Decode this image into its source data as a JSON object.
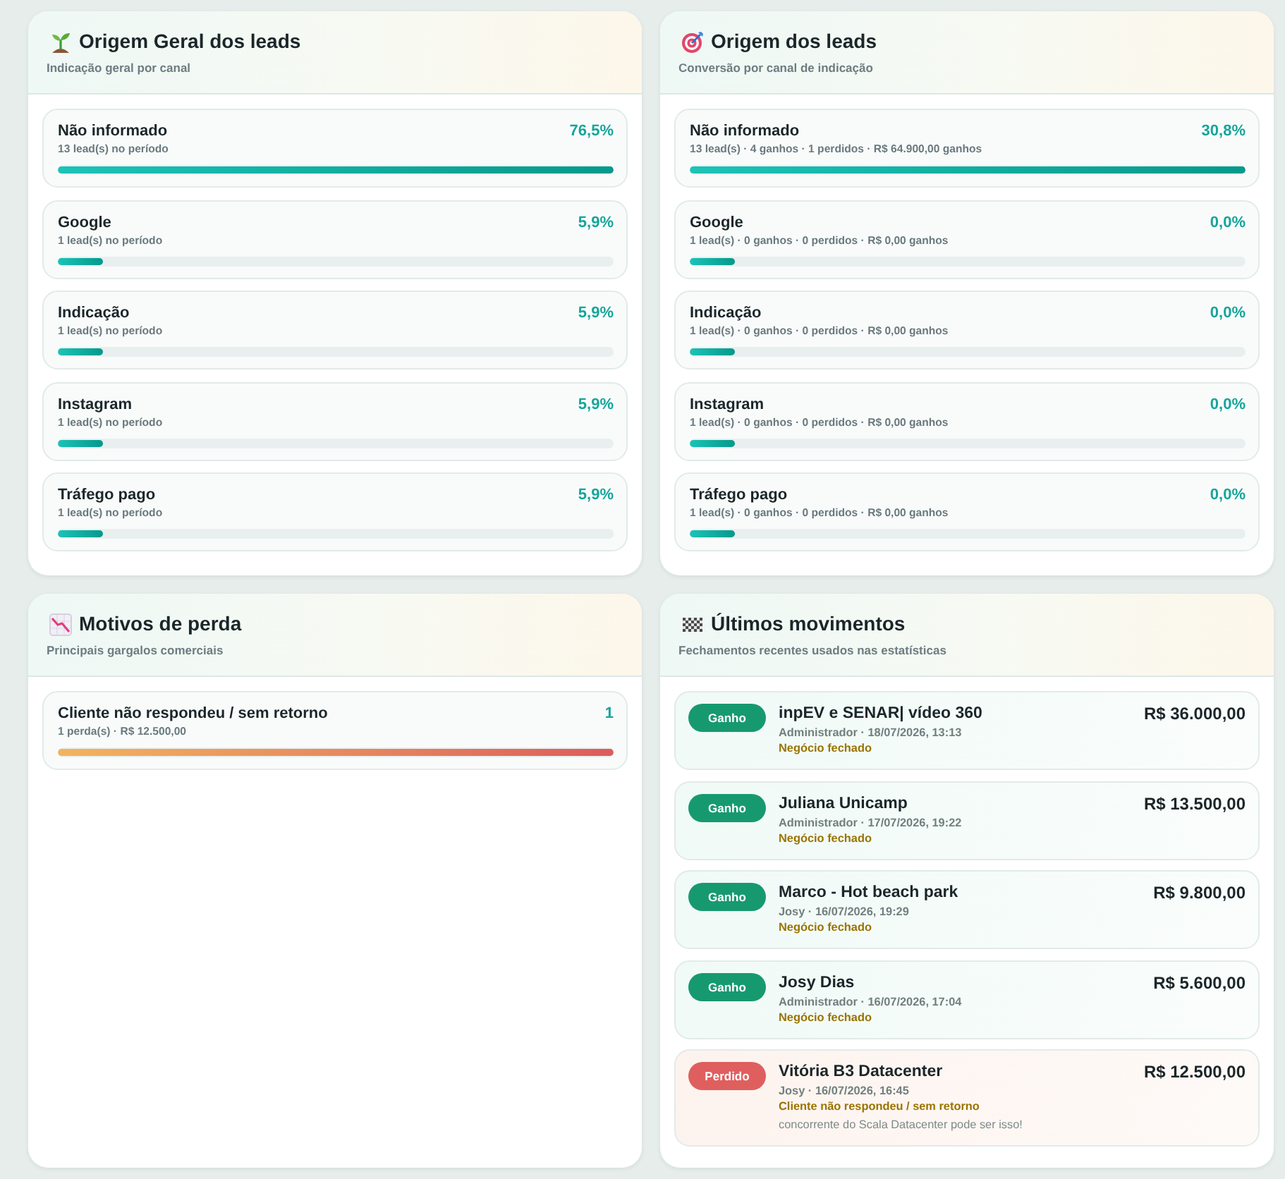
{
  "lead_origin_overview": {
    "title": "Origem Geral dos leads",
    "subtitle": "Indicação geral por canal",
    "rows": [
      {
        "name": "Não informado",
        "detail": "13 lead(s) no período",
        "share": "76,5%",
        "level": 1
      },
      {
        "name": "Google",
        "detail": "1 lead(s) no período",
        "share": "5,9%",
        "level": 0.08
      },
      {
        "name": "Indicação",
        "detail": "1 lead(s) no período",
        "share": "5,9%",
        "level": 0.08
      },
      {
        "name": "Instagram",
        "detail": "1 lead(s) no período",
        "share": "5,9%",
        "level": 0.08
      },
      {
        "name": "Tráfego pago",
        "detail": "1 lead(s) no período",
        "share": "5,9%",
        "level": 0.08
      }
    ]
  },
  "lead_origin_conversion": {
    "title": "Origem dos leads",
    "subtitle": "Conversão por canal de indicação",
    "rows": [
      {
        "name": "Não informado",
        "detail": "13 lead(s) · 4 ganhos · 1 perdidos · R$ 64.900,00 ganhos",
        "share": "30,8%",
        "level": 1
      },
      {
        "name": "Google",
        "detail": "1 lead(s) · 0 ganhos · 0 perdidos · R$ 0,00 ganhos",
        "share": "0,0%",
        "level": 0.08
      },
      {
        "name": "Indicação",
        "detail": "1 lead(s) · 0 ganhos · 0 perdidos · R$ 0,00 ganhos",
        "share": "0,0%",
        "level": 0.08
      },
      {
        "name": "Instagram",
        "detail": "1 lead(s) · 0 ganhos · 0 perdidos · R$ 0,00 ganhos",
        "share": "0,0%",
        "level": 0.08
      },
      {
        "name": "Tráfego pago",
        "detail": "1 lead(s) · 0 ganhos · 0 perdidos · R$ 0,00 ganhos",
        "share": "0,0%",
        "level": 0.08
      }
    ]
  },
  "loss_reasons": {
    "title": "Motivos de perda",
    "subtitle": "Principais gargalos comerciais",
    "rows": [
      {
        "name": "Cliente não respondeu / sem retorno",
        "detail": "1 perda(s) · R$ 12.500,00",
        "count": "1",
        "level": 1
      }
    ]
  },
  "recent_movements": {
    "title": "Últimos movimentos",
    "subtitle": "Fechamentos recentes usados nas estatísticas",
    "items": [
      {
        "kind": "won",
        "status": "Ganho",
        "title": "inpEV e SENAR| vídeo 360",
        "meta": "Administrador · 18/07/2026, 13:13",
        "outcome": "Negócio fechado",
        "amount": "R$ 36.000,00"
      },
      {
        "kind": "won",
        "status": "Ganho",
        "title": "Juliana Unicamp",
        "meta": "Administrador · 17/07/2026, 19:22",
        "outcome": "Negócio fechado",
        "amount": "R$ 13.500,00"
      },
      {
        "kind": "won",
        "status": "Ganho",
        "title": "Marco - Hot beach park",
        "meta": "Josy · 16/07/2026, 19:29",
        "outcome": "Negócio fechado",
        "amount": "R$ 9.800,00"
      },
      {
        "kind": "won",
        "status": "Ganho",
        "title": "Josy Dias",
        "meta": "Administrador · 16/07/2026, 17:04",
        "outcome": "Negócio fechado",
        "amount": "R$ 5.600,00"
      },
      {
        "kind": "lost",
        "status": "Perdido",
        "title": "Vitória B3 Datacenter",
        "meta": "Josy · 16/07/2026, 16:45",
        "outcome": "Cliente não respondeu / sem retorno",
        "note": "concorrente do Scala Datacenter pode ser isso!",
        "amount": "R$ 12.500,00"
      }
    ]
  }
}
